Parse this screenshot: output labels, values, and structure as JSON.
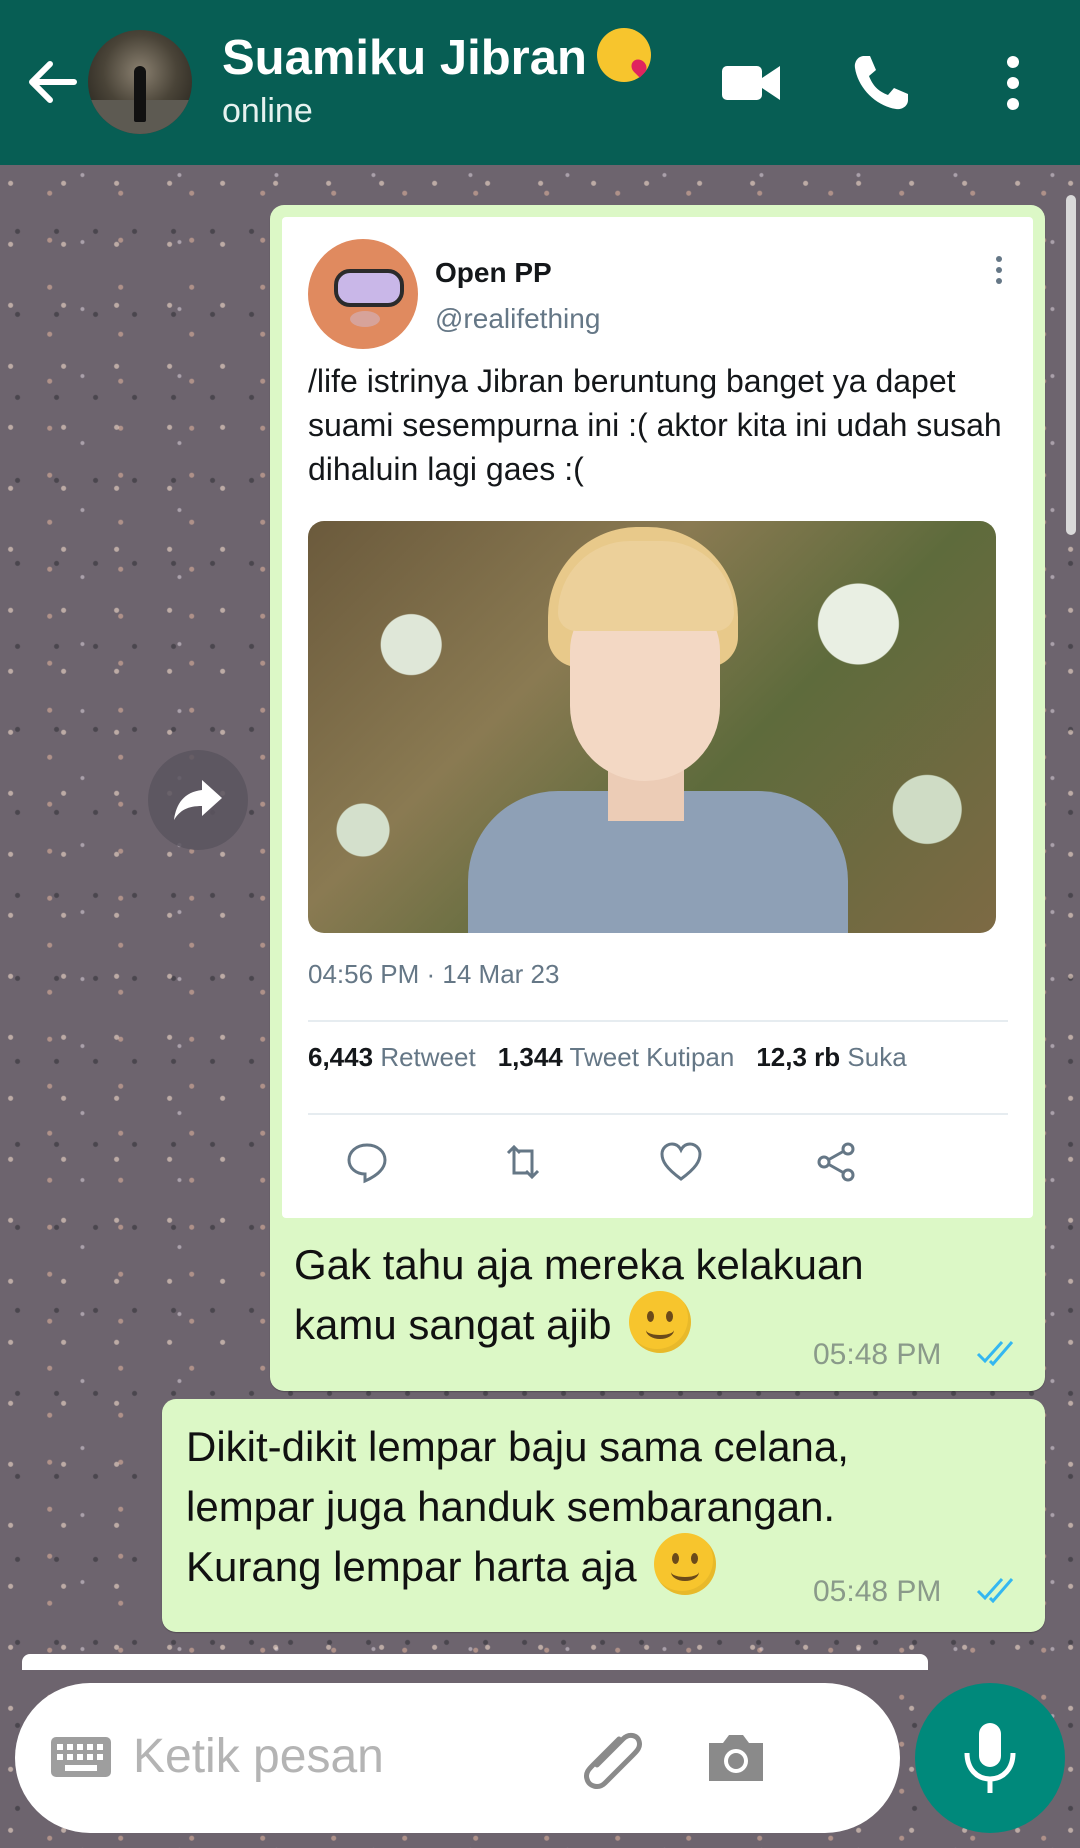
{
  "header": {
    "contact_name": "Suamiku Jibran",
    "contact_emoji": "kiss-emoji",
    "status": "online",
    "icons": [
      "back-arrow-icon",
      "video-call-icon",
      "phone-icon",
      "more-options-icon"
    ]
  },
  "tweet": {
    "name": "Open PP",
    "handle": "@realifething",
    "text": "/life istrinya Jibran beruntung banget ya dapet suami sesempurna ini :( aktor kita ini udah susah dihaluin lagi gaes :(",
    "timestamp": "04:56 PM · 14 Mar 23",
    "retweet_count": "6,443",
    "retweet_label": "Retweet",
    "quote_count": "1,344",
    "quote_label": "Tweet Kutipan",
    "like_count": "12,3 rb",
    "like_label": "Suka"
  },
  "messages": [
    {
      "text": "Gak tahu aja mereka kelakuan kamu sangat ajib",
      "emoji": "slightly-smiling-emoji",
      "time": "05:48 PM",
      "status": "read"
    },
    {
      "text": "Dikit-dikit lempar baju sama celana, lempar juga handuk sembarangan. Kurang lempar harta aja",
      "emoji": "slightly-smiling-emoji",
      "time": "05:48 PM",
      "status": "read"
    }
  ],
  "composer": {
    "placeholder": "Ketik pesan"
  },
  "colors": {
    "header": "#075e54",
    "bubble_out": "#dcf8c6",
    "read_ticks": "#34b7f1",
    "mic_button": "#00897b"
  }
}
